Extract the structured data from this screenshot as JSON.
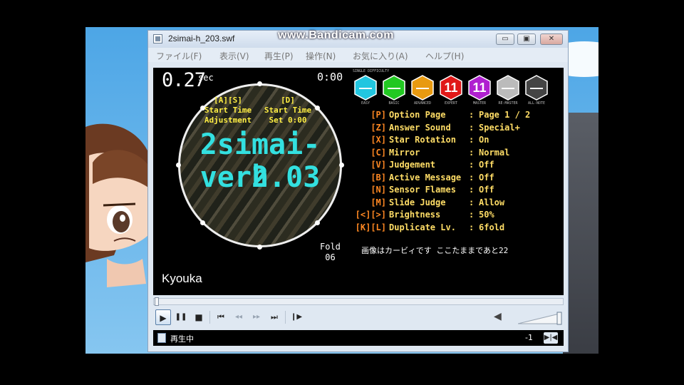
{
  "window": {
    "title": "2simai-h_203.swf",
    "watermark": "www.Bandicam.com",
    "minimize_glyph": "▭",
    "maximize_glyph": "▣",
    "close_glyph": "✕"
  },
  "menu": [
    "ファイル(F)",
    "表示(V)",
    "再生(P)",
    "操作(N)",
    "お気に入り(A)",
    "ヘルプ(H)"
  ],
  "game": {
    "timer_value": "0.27",
    "timer_unit": "sec",
    "clock": "0:00",
    "adjust_key_left": "[A][S]",
    "adjust_label_left_1": "Start Time",
    "adjust_label_left_2": "Adjustment",
    "adjust_key_right": "[D]",
    "adjust_label_right_1": "Start Time",
    "adjust_label_right_2": "Set 0:00",
    "logo_line1": "2simai-h",
    "logo_line2": "ver2.03",
    "player_name": "Kyouka",
    "fold_label": "Fold",
    "fold_value": "06",
    "note": "画像はカービィです ここたままであと22",
    "difficulty_caption": "SINGLE DIFFICULTY",
    "difficulties": [
      {
        "icon": "hexagon-icon",
        "color": "#22c6e0",
        "value": "—",
        "label": "EASY"
      },
      {
        "icon": "hexagon-icon",
        "color": "#22c822",
        "value": "—",
        "label": "BASIC"
      },
      {
        "icon": "hexagon-icon",
        "color": "#e89a10",
        "value": "—",
        "label": "ADVANCED"
      },
      {
        "icon": "hexagon-icon",
        "color": "#e01818",
        "value": "11",
        "label": "EXPERT"
      },
      {
        "icon": "hexagon-icon",
        "color": "#b020d0",
        "value": "11",
        "label": "MASTER"
      },
      {
        "icon": "hexagon-icon",
        "color": "#bbbbbb",
        "value": "—",
        "label": "RE:MASTER"
      },
      {
        "icon": "hexagon-icon",
        "color": "#444444",
        "value": "—",
        "label": "ALL-NOTE"
      }
    ],
    "options": [
      {
        "key": "[P]",
        "name": "Option Page",
        "value": "Page 1 / 2"
      },
      {
        "key": "[Z]",
        "name": "Answer Sound",
        "value": "Special+"
      },
      {
        "key": "[X]",
        "name": "Star Rotation",
        "value": "On"
      },
      {
        "key": "[C]",
        "name": "Mirror",
        "value": "Normal"
      },
      {
        "key": "[V]",
        "name": "Judgement",
        "value": "Off"
      },
      {
        "key": "[B]",
        "name": "Active Message",
        "value": "Off"
      },
      {
        "key": "[N]",
        "name": "Sensor Flames",
        "value": "Off"
      },
      {
        "key": "[M]",
        "name": "Slide Judge",
        "value": "Allow"
      },
      {
        "key": "[<][>]",
        "name": "Brightness",
        "value": "50%"
      },
      {
        "key": "[K][L]",
        "name": "Duplicate Lv.",
        "value": "6fold"
      }
    ]
  },
  "player_controls": {
    "play": "▶",
    "pause": "❚❚",
    "stop": "■",
    "prev": "⏮",
    "rewind": "◂◂",
    "forward": "▸▸",
    "next": "⏭",
    "frame": "❙▶",
    "volume": "◀"
  },
  "status": {
    "text": "再生中",
    "number": "-1",
    "end_glyph": "▶|◀"
  },
  "colors": {
    "option_key": "#ff8822",
    "option_text": "#ffdd66",
    "logo": "#33e0e0",
    "desktop_sky": "#4da6e6"
  }
}
